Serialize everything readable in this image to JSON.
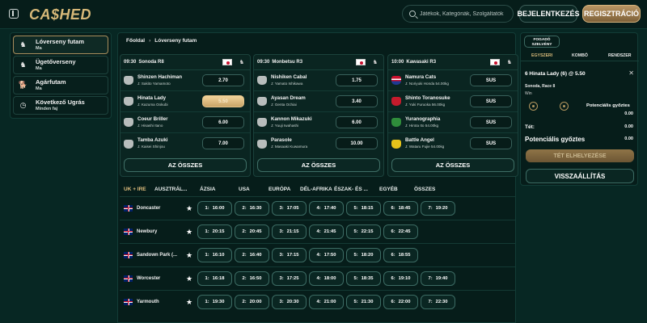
{
  "header": {
    "logo": "CA$HED",
    "search_placeholder": "Játékok, Kategóriák, Szolgáltatók",
    "login_label": "BEJELENTKEZÉS",
    "register_label": "REGISZTRÁCIÓ"
  },
  "sidebar": {
    "items": [
      {
        "title": "Lóverseny futam",
        "sub": "Ma",
        "icon": "horse-head-icon"
      },
      {
        "title": "Ügetőverseny",
        "sub": "Ma",
        "icon": "harness-racing-icon"
      },
      {
        "title": "Agárfutam",
        "sub": "Ma",
        "icon": "greyhound-icon"
      },
      {
        "title": "Következő Ugrás",
        "sub": "Minden faj",
        "icon": "clock-icon"
      }
    ]
  },
  "breadcrumb": {
    "home": "Főoldal",
    "current": "Lóverseny futam"
  },
  "cards": [
    {
      "time": "09:30",
      "venue": "Sonoda R8",
      "entries": [
        {
          "name": "Shinzen Hachiman",
          "jockey": "J: Sakito Yamamoto",
          "odds": "2.70",
          "selected": false
        },
        {
          "name": "Hinata Lady",
          "jockey": "J: Kazuma Ookubi",
          "odds": "5.50",
          "selected": true
        },
        {
          "name": "Coeur Briller",
          "jockey": "J: Hisashi Itano",
          "odds": "6.00",
          "selected": false
        },
        {
          "name": "Tamba Azuki",
          "jockey": "J: Kaisei Shinjou",
          "odds": "7.00",
          "selected": false
        }
      ],
      "all_label": "AZ ÖSSZES"
    },
    {
      "time": "09:30",
      "venue": "Monbetsu R3",
      "entries": [
        {
          "name": "Nishiken Cabal",
          "jockey": "J: Yamato Ishikawa",
          "odds": "1.75",
          "selected": false
        },
        {
          "name": "Ayasan Dream",
          "jockey": "J: Genta Ochiai",
          "odds": "3.40",
          "selected": false
        },
        {
          "name": "Kannon Mikazuki",
          "jockey": "J: Yuuji Iwahashi",
          "odds": "6.00",
          "selected": false
        },
        {
          "name": "Parasole",
          "jockey": "J: Masaaki Kuwamura",
          "odds": "10.00",
          "selected": false
        }
      ],
      "all_label": "AZ ÖSSZES"
    },
    {
      "time": "10:00",
      "venue": "Kawasaki R3",
      "entries": [
        {
          "name": "Namura Cats",
          "jockey": "J: Noriyuki Honda 54.00kg",
          "odds": "SUS",
          "selected": false
        },
        {
          "name": "Shinto Toranosuke",
          "jockey": "J: Yuki Furuoka 56.00kg",
          "odds": "SUS",
          "selected": false
        },
        {
          "name": "Yuranographia",
          "jockey": "J: Hirota Ito 54.00kg",
          "odds": "SUS",
          "selected": false
        },
        {
          "name": "Battle Angel",
          "jockey": "J: Wataru Fujie 54.00kg",
          "odds": "SUS",
          "selected": false
        }
      ],
      "all_label": "AZ ÖSSZES"
    }
  ],
  "region_tabs": [
    "UK + IRE",
    "AUSZTRÁL...",
    "ÁZSIA",
    "USA",
    "EURÓPA",
    "DÉL-AFRIKA",
    "ÉSZAK- ÉS ...",
    "EGYÉB",
    "ÖSSZES"
  ],
  "tracks": [
    {
      "name": "Doncaster",
      "races": [
        [
          "1:",
          "16:00"
        ],
        [
          "2:",
          "16:30"
        ],
        [
          "3:",
          "17:05"
        ],
        [
          "4:",
          "17:40"
        ],
        [
          "5:",
          "18:15"
        ],
        [
          "6:",
          "18:45"
        ],
        [
          "7:",
          "19:20"
        ]
      ]
    },
    {
      "name": "Newbury",
      "races": [
        [
          "1:",
          "20:15"
        ],
        [
          "2:",
          "20:45"
        ],
        [
          "3:",
          "21:15"
        ],
        [
          "4:",
          "21:45"
        ],
        [
          "5:",
          "22:15"
        ],
        [
          "6:",
          "22:45"
        ]
      ]
    },
    {
      "name": "Sandown Park (...",
      "races": [
        [
          "1:",
          "16:10"
        ],
        [
          "2:",
          "16:40"
        ],
        [
          "3:",
          "17:15"
        ],
        [
          "4:",
          "17:50"
        ],
        [
          "5:",
          "18:20"
        ],
        [
          "6:",
          "18:55"
        ]
      ]
    },
    {
      "name": "Worcester",
      "races": [
        [
          "1:",
          "16:18"
        ],
        [
          "2:",
          "16:50"
        ],
        [
          "3:",
          "17:25"
        ],
        [
          "4:",
          "18:00"
        ],
        [
          "5:",
          "18:35"
        ],
        [
          "6:",
          "19:10"
        ],
        [
          "7:",
          "19:40"
        ]
      ]
    },
    {
      "name": "Yarmouth",
      "races": [
        [
          "1:",
          "19:30"
        ],
        [
          "2:",
          "20:00"
        ],
        [
          "3:",
          "20:30"
        ],
        [
          "4:",
          "21:00"
        ],
        [
          "5:",
          "21:30"
        ],
        [
          "6:",
          "22:00"
        ],
        [
          "7:",
          "22:30"
        ]
      ]
    }
  ],
  "betslip": {
    "type_label": "FOGADÓ SZELVÉNY",
    "tabs": [
      "EGYSZERI",
      "KOMBÓ",
      "RENDSZER"
    ],
    "selection": "6 Hinata Lady (6) @ 5.50",
    "race": "Sonoda, Race 8",
    "market": "Win",
    "potential_label": "Potenciális győztes",
    "potential_value": "0.00",
    "stake_label": "Tét:",
    "stake_value": "0.00",
    "total_potential_label": "Potenciális győztes",
    "total_potential_value": "0.00",
    "place_label": "TÉT ELHELYEZÉSE",
    "reset_label": "VISSZAÁLLÍTÁS"
  }
}
